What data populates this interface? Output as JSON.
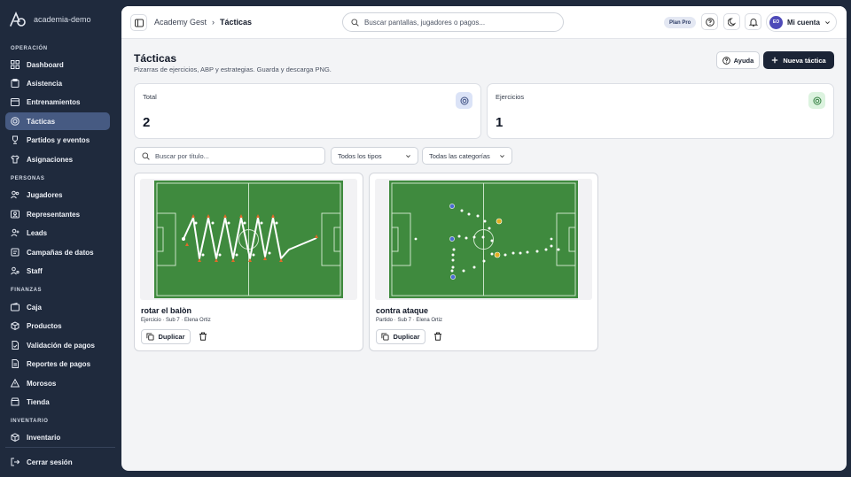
{
  "app": {
    "org_name": "academia-demo"
  },
  "sidebar": {
    "sections": [
      {
        "title": "OPERACIÓN"
      },
      {
        "title": "PERSONAS"
      },
      {
        "title": "FINANZAS"
      },
      {
        "title": "INVENTARIO"
      }
    ],
    "items": [
      {
        "label": "Dashboard",
        "icon": "grid-icon"
      },
      {
        "label": "Asistencia",
        "icon": "clipboard-icon"
      },
      {
        "label": "Entrenamientos",
        "icon": "calendar-icon"
      },
      {
        "label": "Tácticas",
        "icon": "target-icon",
        "active": true
      },
      {
        "label": "Partidos y eventos",
        "icon": "trophy-icon"
      },
      {
        "label": "Asignaciones",
        "icon": "shirt-icon"
      },
      {
        "label": "Jugadores",
        "icon": "users-icon"
      },
      {
        "label": "Representantes",
        "icon": "id-card-icon"
      },
      {
        "label": "Leads",
        "icon": "user-plus-icon"
      },
      {
        "label": "Campañas de datos",
        "icon": "database-icon"
      },
      {
        "label": "Staff",
        "icon": "user-key-icon"
      },
      {
        "label": "Caja",
        "icon": "wallet-icon"
      },
      {
        "label": "Productos",
        "icon": "box-icon"
      },
      {
        "label": "Validación de pagos",
        "icon": "file-check-icon"
      },
      {
        "label": "Reportes de pagos",
        "icon": "file-text-icon"
      },
      {
        "label": "Morosos",
        "icon": "alert-icon"
      },
      {
        "label": "Tienda",
        "icon": "store-icon"
      },
      {
        "label": "Inventario",
        "icon": "package-icon"
      }
    ],
    "logout": "Cerrar sesión"
  },
  "topbar": {
    "breadcrumb": [
      "Academy Gest",
      "Tácticas"
    ],
    "search_placeholder": "Buscar pantallas, jugadores o pagos...",
    "plan": "Plan Pro",
    "avatar_initials": "EO",
    "account_label": "Mi cuenta"
  },
  "page": {
    "title": "Tácticas",
    "subtitle": "Pizarras de ejercicios, ABP y estrategias. Guarda y descarga PNG.",
    "help_label": "Ayuda",
    "new_label": "Nueva táctica"
  },
  "stats": [
    {
      "label": "Total",
      "value": "2",
      "accent": "#dbe3f7"
    },
    {
      "label": "Ejercicios",
      "value": "1",
      "accent": "#dcf3df"
    }
  ],
  "filters": {
    "search_placeholder": "Buscar por título...",
    "type_value": "Todos los tipos",
    "category_value": "Todas las categorías"
  },
  "tactics": [
    {
      "title": "rotar el balòn",
      "meta": "Ejercicio · Sub 7 · Elena Ortiz",
      "duplicate_label": "Duplicar"
    },
    {
      "title": "contra ataque",
      "meta": "Partido · Sub 7 · Elena Ortiz",
      "duplicate_label": "Duplicar"
    }
  ],
  "colors": {
    "pitch": "#3f8a3e",
    "sidebar_bg": "#1f2a3d",
    "active_nav": "#465a82",
    "primary_btn": "#1b2436"
  }
}
